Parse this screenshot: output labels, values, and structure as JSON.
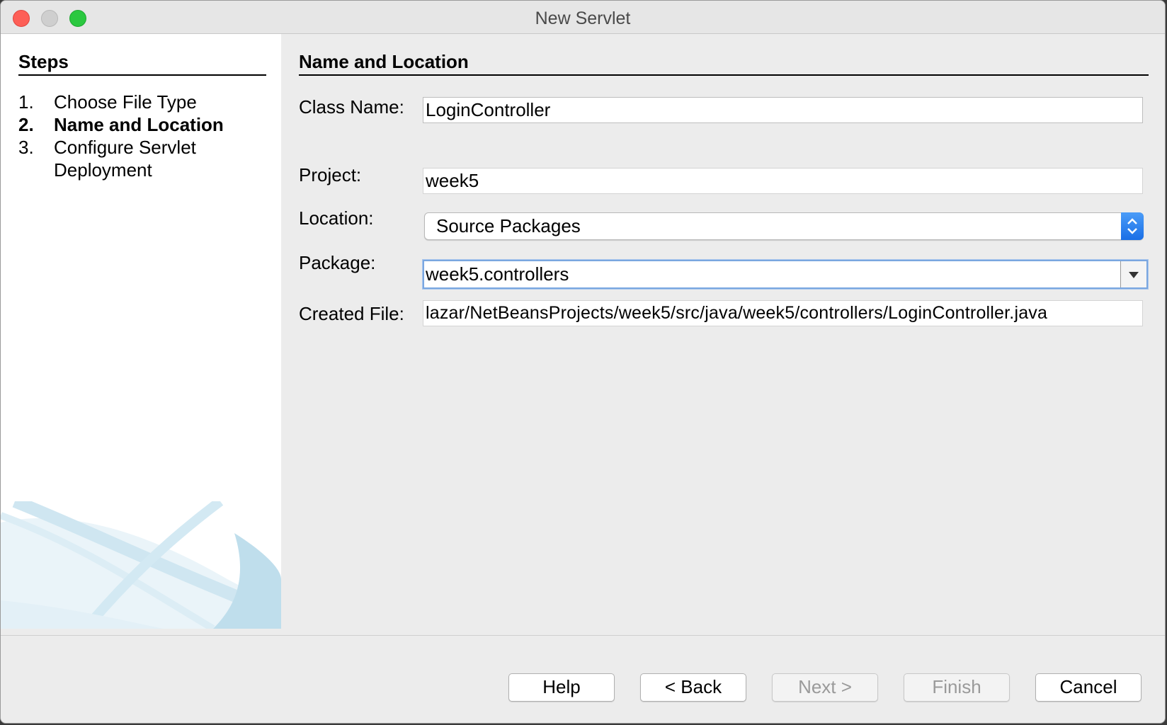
{
  "window": {
    "title": "New Servlet"
  },
  "steps": {
    "heading": "Steps",
    "items": [
      {
        "num": "1.",
        "label": "Choose File Type"
      },
      {
        "num": "2.",
        "label": "Name and Location"
      },
      {
        "num": "3.",
        "label": "Configure Servlet Deployment"
      }
    ],
    "current_index": 1
  },
  "form": {
    "section_title": "Name and Location",
    "class_name": {
      "label": "Class Name:",
      "value": "LoginController"
    },
    "project": {
      "label": "Project:",
      "value": "week5"
    },
    "location": {
      "label": "Location:",
      "value": "Source Packages"
    },
    "package": {
      "label": "Package:",
      "value": "week5.controllers"
    },
    "created_file": {
      "label": "Created File:",
      "value": "lazar/NetBeansProjects/week5/src/java/week5/controllers/LoginController.java"
    }
  },
  "buttons": {
    "help": "Help",
    "back": "< Back",
    "next": "Next >",
    "finish": "Finish",
    "cancel": "Cancel"
  },
  "colors": {
    "accent": "#1a6fe6",
    "focus_ring": "#7aa7e0"
  }
}
